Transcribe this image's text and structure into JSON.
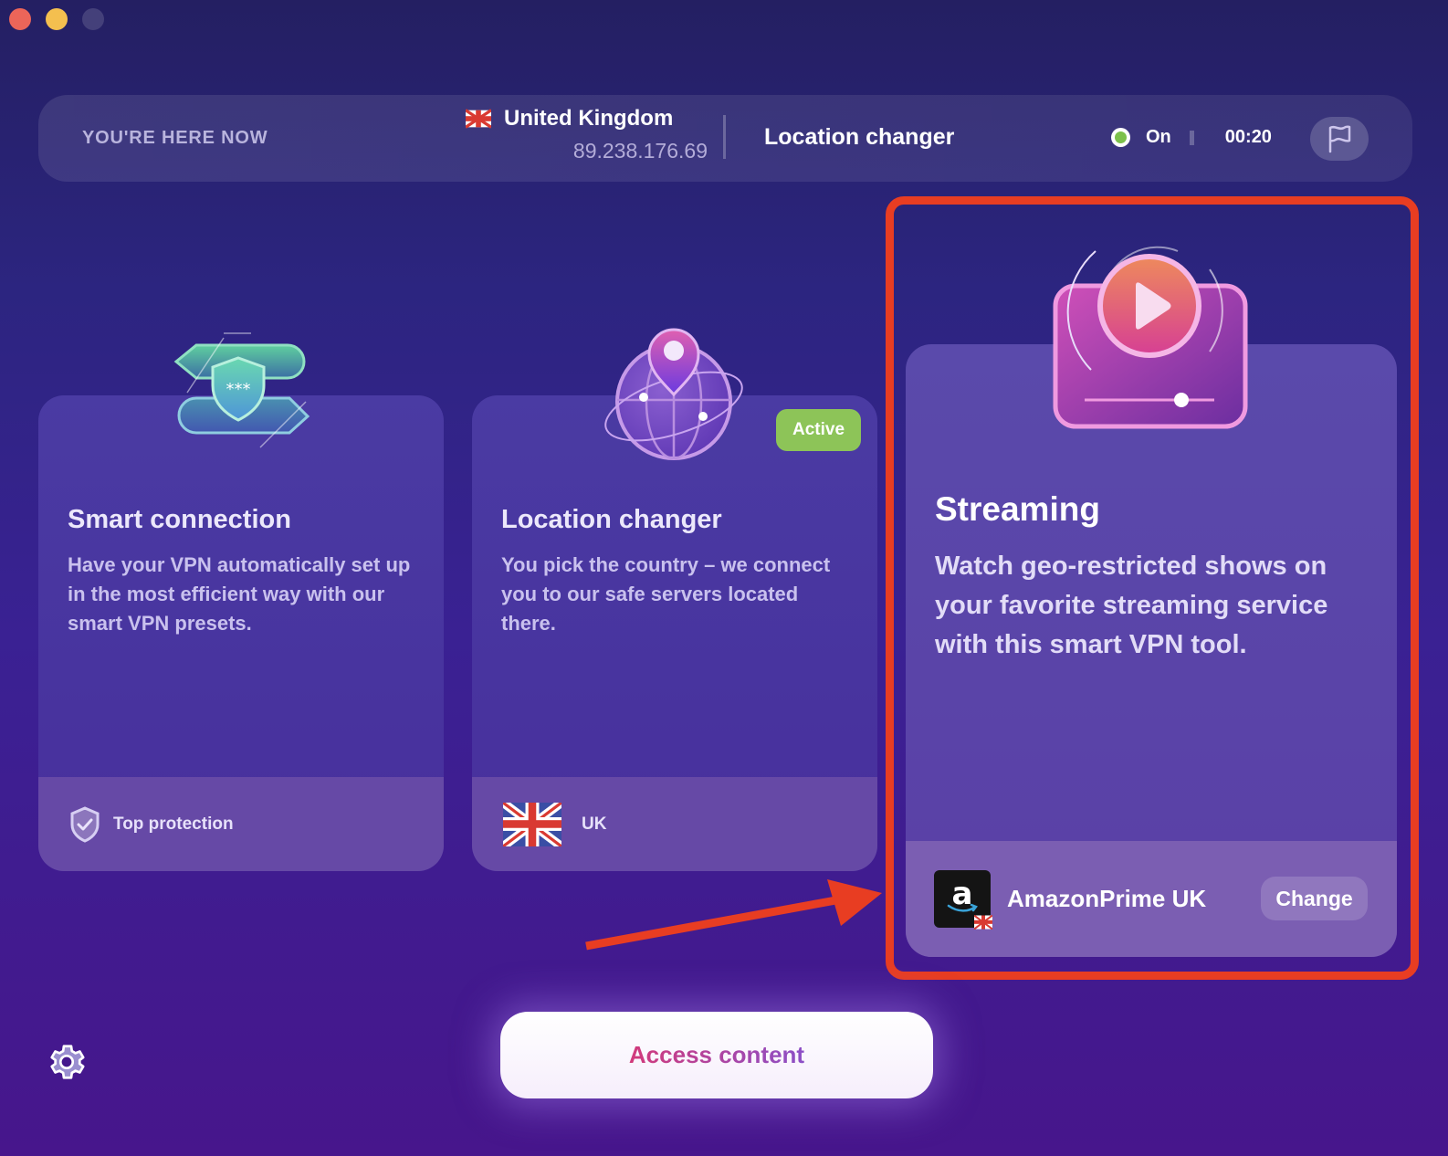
{
  "window": {
    "controls": [
      "close",
      "minimize",
      "maximize"
    ]
  },
  "status_bar": {
    "here_label": "YOU'RE HERE NOW",
    "country": "United Kingdom",
    "country_flag": "uk-flag-icon",
    "ip": "89.238.176.69",
    "mode": "Location changer",
    "connection_state": "On",
    "connection_color": "#7cc04b",
    "timer": "00:20",
    "flag_button_icon": "flag-icon"
  },
  "cards": [
    {
      "title": "Smart connection",
      "description": "Have your VPN automatically set up in the most efficient way with our smart VPN presets.",
      "footer_icon": "shield-check-icon",
      "footer_text": "Top protection"
    },
    {
      "title": "Location changer",
      "description": "You pick the country – we connect you to our safe servers located there.",
      "badge": "Active",
      "badge_color": "#8dc458",
      "footer_icon": "uk-flag-icon",
      "footer_text": "UK"
    },
    {
      "title": "Streaming",
      "description": "Watch geo-restricted shows on your favorite streaming service with this smart VPN tool.",
      "service_icon": "amazon-logo-icon",
      "service_name": "AmazonPrime UK",
      "change_label": "Change"
    }
  ],
  "annotation": {
    "highlight_color": "#e83d22",
    "highlight_target": "Streaming"
  },
  "footer": {
    "settings_icon": "gear-icon",
    "primary_button": "Access content"
  }
}
